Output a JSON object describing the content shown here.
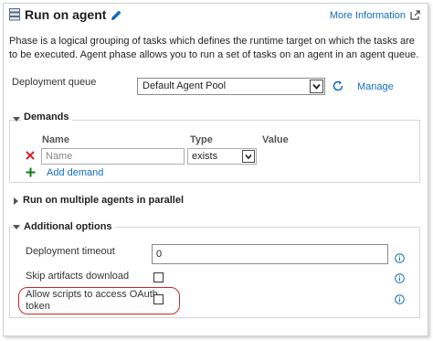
{
  "header": {
    "title": "Run on agent",
    "more_info": "More Information"
  },
  "description": "Phase is a logical grouping of tasks which defines the runtime target on which the tasks are to be executed. Agent phase allows you to run a set of tasks on an agent in an agent queue.",
  "deployment_queue": {
    "label": "Deployment queue",
    "value": "Default Agent Pool",
    "manage": "Manage"
  },
  "demands": {
    "heading": "Demands",
    "columns": [
      "Name",
      "Type",
      "Value"
    ],
    "rows": [
      {
        "name_placeholder": "Name",
        "type": "exists",
        "value": ""
      }
    ],
    "add_label": "Add demand"
  },
  "parallel": {
    "heading": "Run on multiple agents in parallel"
  },
  "additional": {
    "heading": "Additional options",
    "timeout_label": "Deployment timeout",
    "timeout_value": "0",
    "skip_label": "Skip artifacts download",
    "skip_checked": false,
    "oauth_label_line1": "Allow scripts to access OAuth",
    "oauth_label_line2": "token",
    "oauth_checked": false
  },
  "colors": {
    "link": "#106ebe",
    "remove_x": "#d2232a",
    "add_plus": "#107c10",
    "highlight": "#d2232a"
  },
  "icons": {
    "title": "server-icon",
    "edit": "pencil-icon",
    "external": "external-link-icon",
    "refresh": "refresh-icon",
    "remove": "close-icon",
    "add": "plus-icon",
    "info": "info-icon"
  }
}
